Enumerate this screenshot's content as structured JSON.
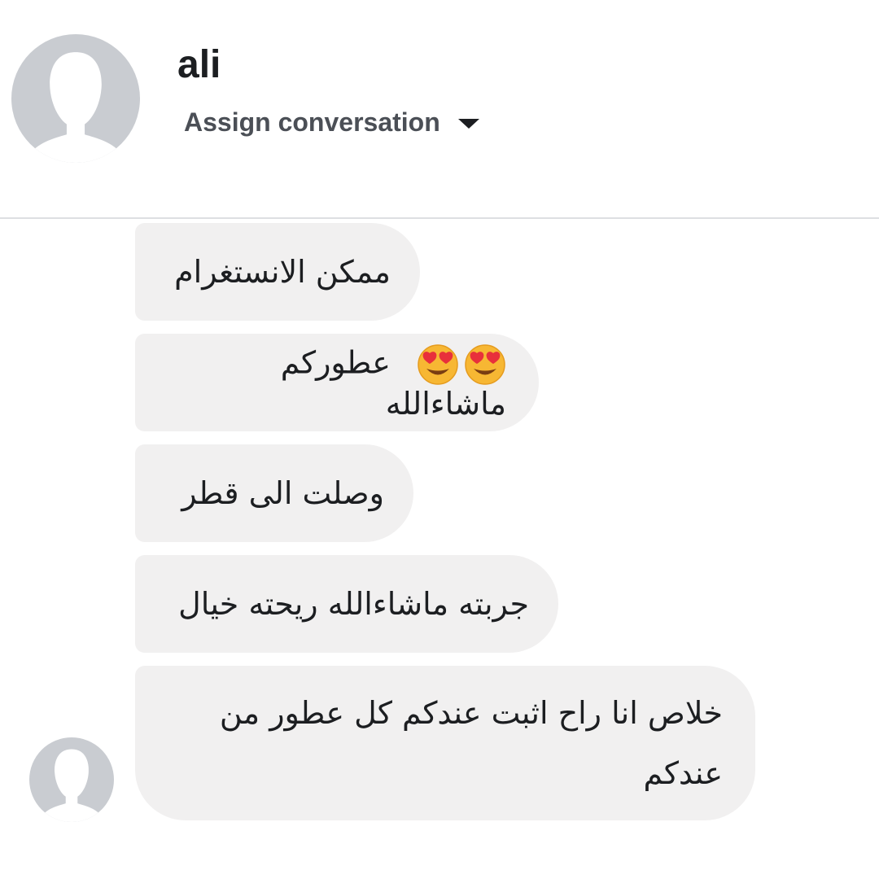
{
  "header": {
    "name": "ali",
    "assign_label": "Assign conversation",
    "assign_icon": "caret-down-icon"
  },
  "messages": [
    {
      "text": "ممكن الانستغرام"
    },
    {
      "text": "عطوركم ماشاءالله",
      "emoji": [
        "heart-eyes-icon",
        "heart-eyes-icon"
      ]
    },
    {
      "text": "وصلت الى قطر"
    },
    {
      "text": "جربته ماشاءالله ريحته خيال"
    },
    {
      "text": "خلاص انا راح اثبت عندكم كل عطور من عندكم"
    }
  ],
  "colors": {
    "bubble": "#f1f0f0",
    "avatar_placeholder": "#c9ccd1",
    "text": "#1c1e21",
    "secondary_text": "#4b4f56"
  }
}
